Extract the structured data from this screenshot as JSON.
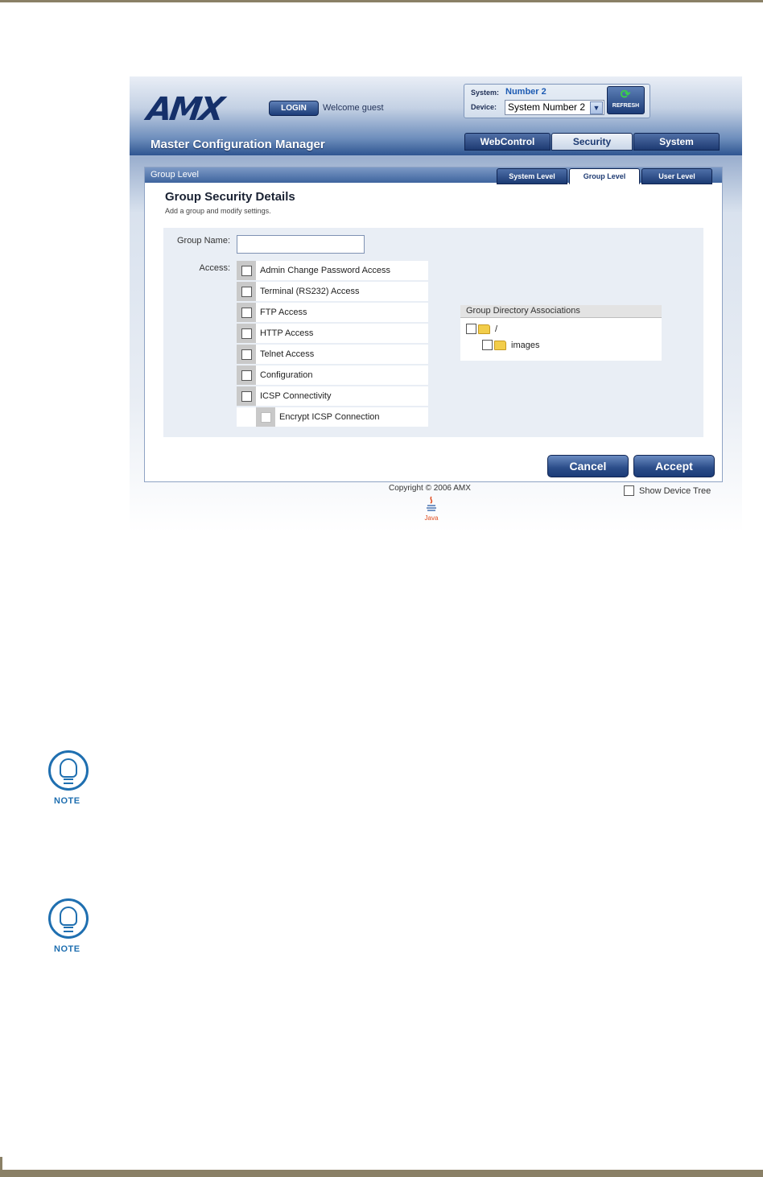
{
  "app": {
    "logo": "AMX",
    "login_label": "LOGIN",
    "welcome": "Welcome guest",
    "title": "Master Configuration Manager",
    "system_label": "System:",
    "system_value": "Number 2",
    "device_label": "Device:",
    "device_value": "System Number 2",
    "refresh_label": "REFRESH",
    "main_tabs": [
      "WebControl",
      "Security",
      "System"
    ],
    "active_main_tab": "Security"
  },
  "panel": {
    "header": "Group Level",
    "sub_tabs": [
      "System Level",
      "Group Level",
      "User Level"
    ],
    "active_sub_tab": "Group Level",
    "title": "Group Security Details",
    "subtitle": "Add a group and modify settings.",
    "group_name_label": "Group Name:",
    "group_name_value": "",
    "access_label": "Access:",
    "access_items": [
      "Admin Change Password Access",
      "Terminal (RS232) Access",
      "FTP Access",
      "HTTP Access",
      "Telnet Access",
      "Configuration",
      "ICSP Connectivity",
      "Encrypt ICSP Connection"
    ],
    "directory_title": "Group Directory Associations",
    "directories": [
      "/",
      "images"
    ]
  },
  "actions": {
    "cancel": "Cancel",
    "accept": "Accept"
  },
  "footer": {
    "copyright": "Copyright © 2006 AMX",
    "show_device_tree": "Show Device Tree",
    "java_label": "Java"
  },
  "notes": {
    "label": "NOTE"
  }
}
